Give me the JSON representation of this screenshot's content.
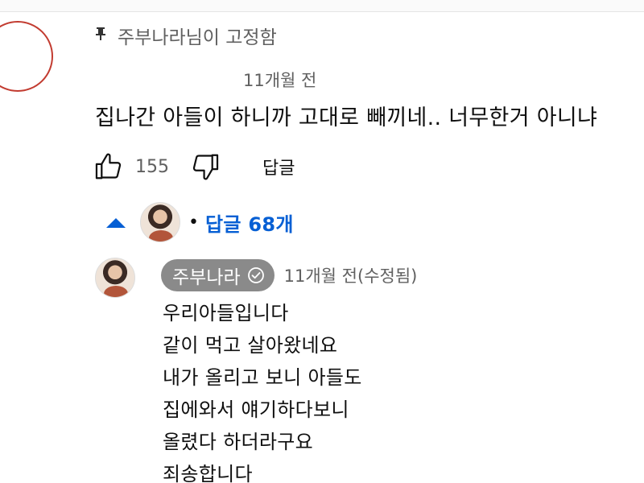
{
  "comment": {
    "pinned_label": "주부나라님이 고정함",
    "timestamp": "11개월 전",
    "text": "집나간 아들이 하니까 고대로 빼끼네.. 너무한거 아니냐",
    "like_count": "155",
    "reply_label": "답글",
    "icons": [
      "pin-icon",
      "thumbs-up-icon",
      "thumbs-down-icon"
    ]
  },
  "replies": {
    "toggle_label": "답글 68개",
    "separator": "•",
    "accent_color": "#065fd4",
    "icons": [
      "caret-up-icon"
    ]
  },
  "reply": {
    "author": "주부나라",
    "timestamp": "11개월 전(수정됨)",
    "lines": [
      "우리아들입니다",
      "같이 먹고 살아왔네요",
      "내가 올리고 보니 아들도",
      "집에와서 얘기하다보니",
      "올렸다 하더라구요",
      "죄송합니다"
    ],
    "icons": [
      "verified-check-icon"
    ]
  }
}
